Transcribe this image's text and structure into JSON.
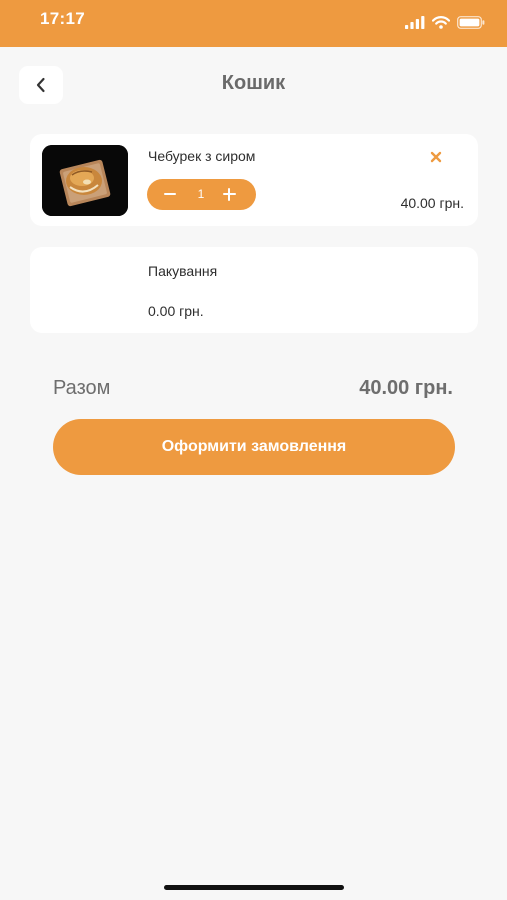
{
  "status_bar": {
    "time": "17:17",
    "icons": [
      "signal-icon",
      "wifi-icon",
      "battery-icon"
    ],
    "color": "#ee9a40"
  },
  "header": {
    "title": "Кошик",
    "back_icon": "chevron-left-icon"
  },
  "cart": {
    "items": [
      {
        "name": "Чебурек з сиром",
        "quantity": "1",
        "price": "40.00 грн.",
        "remove_icon": "close-icon",
        "minus_icon": "minus-icon",
        "plus_icon": "plus-icon"
      }
    ],
    "packaging": {
      "name": "Пакування",
      "price": "0.00 грн."
    }
  },
  "summary": {
    "total_label": "Разом",
    "total_value": "40.00 грн."
  },
  "checkout": {
    "label": "Оформити замовлення"
  },
  "colors": {
    "accent": "#ee9a40",
    "background": "#f7f7f7",
    "card": "#ffffff"
  }
}
